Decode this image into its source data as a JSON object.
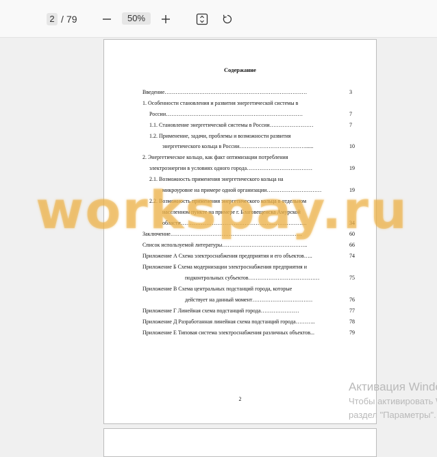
{
  "toolbar": {
    "page_current": "2",
    "page_separator": "/",
    "page_total": "79",
    "zoom": "50%",
    "zoom_out_icon": "minus-icon",
    "zoom_in_icon": "plus-icon",
    "fit_icon": "fit-page-icon",
    "rotate_icon": "rotate-icon"
  },
  "document": {
    "title": "Содержание",
    "toc": [
      {
        "text": "Введение……………………………………………………………………",
        "page": "3"
      },
      {
        "text": "1. Особенности становления и развития энергетической системы в",
        "page": ""
      },
      {
        "text": "России…………………………………………………………………",
        "page": "7"
      },
      {
        "text": "1.1.  Становление энергетической системы в России……………………",
        "page": "7"
      },
      {
        "text": "1.2.  Применение, задачи, проблемы и возможности развития",
        "page": ""
      },
      {
        "text": "энергетического кольца в России………………………………......",
        "page": "10"
      },
      {
        "text": "2. Энергетическое кольцо, как факт оптимизации потребления",
        "page": ""
      },
      {
        "text": "электроэнергии в условиях одного города………………………………",
        "page": "19"
      },
      {
        "text": "2.1.  Возможность применения энергетического кольца на",
        "page": ""
      },
      {
        "text": "микроуровне на примере одной организации…………………………",
        "page": "19"
      },
      {
        "text": "2.2.  Возможность применения энергетического кольца в отдельном",
        "page": ""
      },
      {
        "text": "населенном пункте на примере г. Благовещенска Амурской",
        "page": ""
      },
      {
        "text": "области…………………………………………………………....",
        "page": "34"
      },
      {
        "text": "Заключение………………………………………………………………",
        "page": "60"
      },
      {
        "text": "Список используемой литературы………………………………………..",
        "page": "66"
      },
      {
        "text": "Приложение А Схема электроснабжения предприятия и его объектов…..",
        "page": "74"
      },
      {
        "text": "Приложение Б Схема модернизации электроснабжения предприятия и",
        "page": ""
      },
      {
        "text": "подконтрольных субъектов…………………………………",
        "page": "75"
      },
      {
        "text": "Приложение В Схема центральных подстанций города, которые",
        "page": ""
      },
      {
        "text": "действует на данный момент……………………………",
        "page": "76"
      },
      {
        "text": "Приложение Г Линейная схема подстанций города…………………",
        "page": "77"
      },
      {
        "text": "Приложение Д Разработанная линейная схема подстанций города………..",
        "page": "78"
      },
      {
        "text": "Приложение Е Типовая система электроснабжения различных объектов...",
        "page": "79"
      }
    ],
    "page_number": "2"
  },
  "watermark": "workspay.ru",
  "activation": {
    "title": "Активация Windows",
    "line1": "Чтобы активировать Windows, перейдите в",
    "line2": "раздел \"Параметры\"."
  }
}
